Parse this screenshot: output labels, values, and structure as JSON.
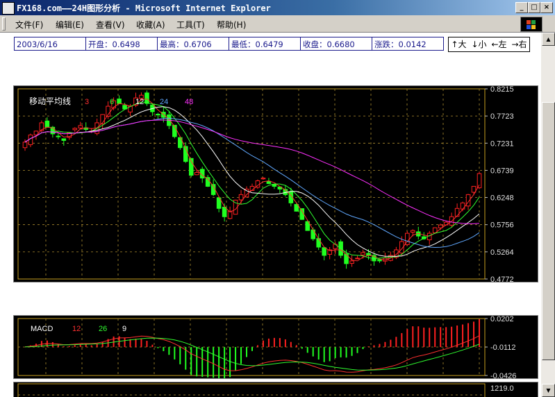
{
  "window": {
    "title": "FX168.com——24H图形分析 - Microsoft Internet Explorer"
  },
  "menu": [
    {
      "label": "文件(F)"
    },
    {
      "label": "编辑(E)"
    },
    {
      "label": "查看(V)"
    },
    {
      "label": "收藏(A)"
    },
    {
      "label": "工具(T)"
    },
    {
      "label": "帮助(H)"
    }
  ],
  "quote": {
    "date": "2003/6/16",
    "open": "开盘：0.6498",
    "high": "最高：0.6706",
    "low": "最低：0.6479",
    "close": "收盘：0.6680",
    "change": "涨跌：0.0142"
  },
  "nav": {
    "zoom_in": "↑大",
    "zoom_out": "↓小",
    "left": "←左",
    "right": "→右"
  },
  "chart_data": [
    {
      "type": "candlestick",
      "legend_title": "移动平均线",
      "ma_periods": [
        {
          "name": "3",
          "color": "#ff3030"
        },
        {
          "name": "6",
          "color": "#30ff30"
        },
        {
          "name": "12",
          "color": "#ffffff"
        },
        {
          "name": "24",
          "color": "#60a8ff"
        },
        {
          "name": "48",
          "color": "#ff30ff"
        }
      ],
      "y_ticks": [
        "0.8215",
        "0.7723",
        "0.7231",
        "0.6739",
        "0.6248",
        "0.5756",
        "0.5264",
        "0.4772"
      ],
      "ylim": [
        0.4772,
        0.8215
      ],
      "close_series": [
        0.725,
        0.738,
        0.745,
        0.76,
        0.752,
        0.74,
        0.735,
        0.728,
        0.742,
        0.75,
        0.755,
        0.748,
        0.745,
        0.76,
        0.775,
        0.79,
        0.8,
        0.795,
        0.785,
        0.79,
        0.805,
        0.81,
        0.795,
        0.78,
        0.775,
        0.77,
        0.755,
        0.735,
        0.715,
        0.69,
        0.665,
        0.67,
        0.66,
        0.645,
        0.63,
        0.605,
        0.59,
        0.6,
        0.62,
        0.63,
        0.64,
        0.645,
        0.655,
        0.66,
        0.65,
        0.645,
        0.64,
        0.63,
        0.615,
        0.6,
        0.585,
        0.565,
        0.55,
        0.535,
        0.52,
        0.53,
        0.54,
        0.52,
        0.505,
        0.51,
        0.515,
        0.525,
        0.52,
        0.51,
        0.51,
        0.515,
        0.52,
        0.53,
        0.545,
        0.56,
        0.565,
        0.555,
        0.55,
        0.56,
        0.57,
        0.575,
        0.58,
        0.59,
        0.605,
        0.615,
        0.63,
        0.645,
        0.668
      ]
    },
    {
      "type": "line",
      "title": "MACD",
      "params": [
        "12",
        "26",
        "9"
      ],
      "y_ticks": [
        "0.0202",
        "-0.0112",
        "-0.0426"
      ],
      "ylim": [
        -0.0426,
        0.0202
      ]
    },
    {
      "type": "bar",
      "y_ticks": [
        "1219.0"
      ]
    }
  ]
}
